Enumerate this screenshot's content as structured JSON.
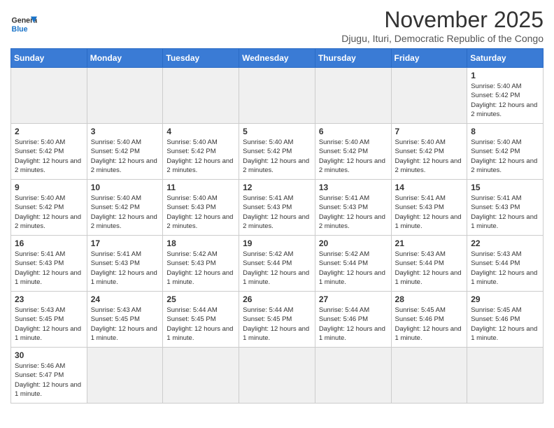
{
  "header": {
    "logo_line1": "General",
    "logo_line2": "Blue",
    "month_title": "November 2025",
    "subtitle": "Djugu, Ituri, Democratic Republic of the Congo"
  },
  "weekdays": [
    "Sunday",
    "Monday",
    "Tuesday",
    "Wednesday",
    "Thursday",
    "Friday",
    "Saturday"
  ],
  "days": {
    "1": "Sunrise: 5:40 AM\nSunset: 5:42 PM\nDaylight: 12 hours and 2 minutes.",
    "2": "Sunrise: 5:40 AM\nSunset: 5:42 PM\nDaylight: 12 hours and 2 minutes.",
    "3": "Sunrise: 5:40 AM\nSunset: 5:42 PM\nDaylight: 12 hours and 2 minutes.",
    "4": "Sunrise: 5:40 AM\nSunset: 5:42 PM\nDaylight: 12 hours and 2 minutes.",
    "5": "Sunrise: 5:40 AM\nSunset: 5:42 PM\nDaylight: 12 hours and 2 minutes.",
    "6": "Sunrise: 5:40 AM\nSunset: 5:42 PM\nDaylight: 12 hours and 2 minutes.",
    "7": "Sunrise: 5:40 AM\nSunset: 5:42 PM\nDaylight: 12 hours and 2 minutes.",
    "8": "Sunrise: 5:40 AM\nSunset: 5:42 PM\nDaylight: 12 hours and 2 minutes.",
    "9": "Sunrise: 5:40 AM\nSunset: 5:42 PM\nDaylight: 12 hours and 2 minutes.",
    "10": "Sunrise: 5:40 AM\nSunset: 5:42 PM\nDaylight: 12 hours and 2 minutes.",
    "11": "Sunrise: 5:40 AM\nSunset: 5:43 PM\nDaylight: 12 hours and 2 minutes.",
    "12": "Sunrise: 5:41 AM\nSunset: 5:43 PM\nDaylight: 12 hours and 2 minutes.",
    "13": "Sunrise: 5:41 AM\nSunset: 5:43 PM\nDaylight: 12 hours and 2 minutes.",
    "14": "Sunrise: 5:41 AM\nSunset: 5:43 PM\nDaylight: 12 hours and 1 minute.",
    "15": "Sunrise: 5:41 AM\nSunset: 5:43 PM\nDaylight: 12 hours and 1 minute.",
    "16": "Sunrise: 5:41 AM\nSunset: 5:43 PM\nDaylight: 12 hours and 1 minute.",
    "17": "Sunrise: 5:41 AM\nSunset: 5:43 PM\nDaylight: 12 hours and 1 minute.",
    "18": "Sunrise: 5:42 AM\nSunset: 5:43 PM\nDaylight: 12 hours and 1 minute.",
    "19": "Sunrise: 5:42 AM\nSunset: 5:44 PM\nDaylight: 12 hours and 1 minute.",
    "20": "Sunrise: 5:42 AM\nSunset: 5:44 PM\nDaylight: 12 hours and 1 minute.",
    "21": "Sunrise: 5:43 AM\nSunset: 5:44 PM\nDaylight: 12 hours and 1 minute.",
    "22": "Sunrise: 5:43 AM\nSunset: 5:44 PM\nDaylight: 12 hours and 1 minute.",
    "23": "Sunrise: 5:43 AM\nSunset: 5:45 PM\nDaylight: 12 hours and 1 minute.",
    "24": "Sunrise: 5:43 AM\nSunset: 5:45 PM\nDaylight: 12 hours and 1 minute.",
    "25": "Sunrise: 5:44 AM\nSunset: 5:45 PM\nDaylight: 12 hours and 1 minute.",
    "26": "Sunrise: 5:44 AM\nSunset: 5:45 PM\nDaylight: 12 hours and 1 minute.",
    "27": "Sunrise: 5:44 AM\nSunset: 5:46 PM\nDaylight: 12 hours and 1 minute.",
    "28": "Sunrise: 5:45 AM\nSunset: 5:46 PM\nDaylight: 12 hours and 1 minute.",
    "29": "Sunrise: 5:45 AM\nSunset: 5:46 PM\nDaylight: 12 hours and 1 minute.",
    "30": "Sunrise: 5:46 AM\nSunset: 5:47 PM\nDaylight: 12 hours and 1 minute."
  }
}
